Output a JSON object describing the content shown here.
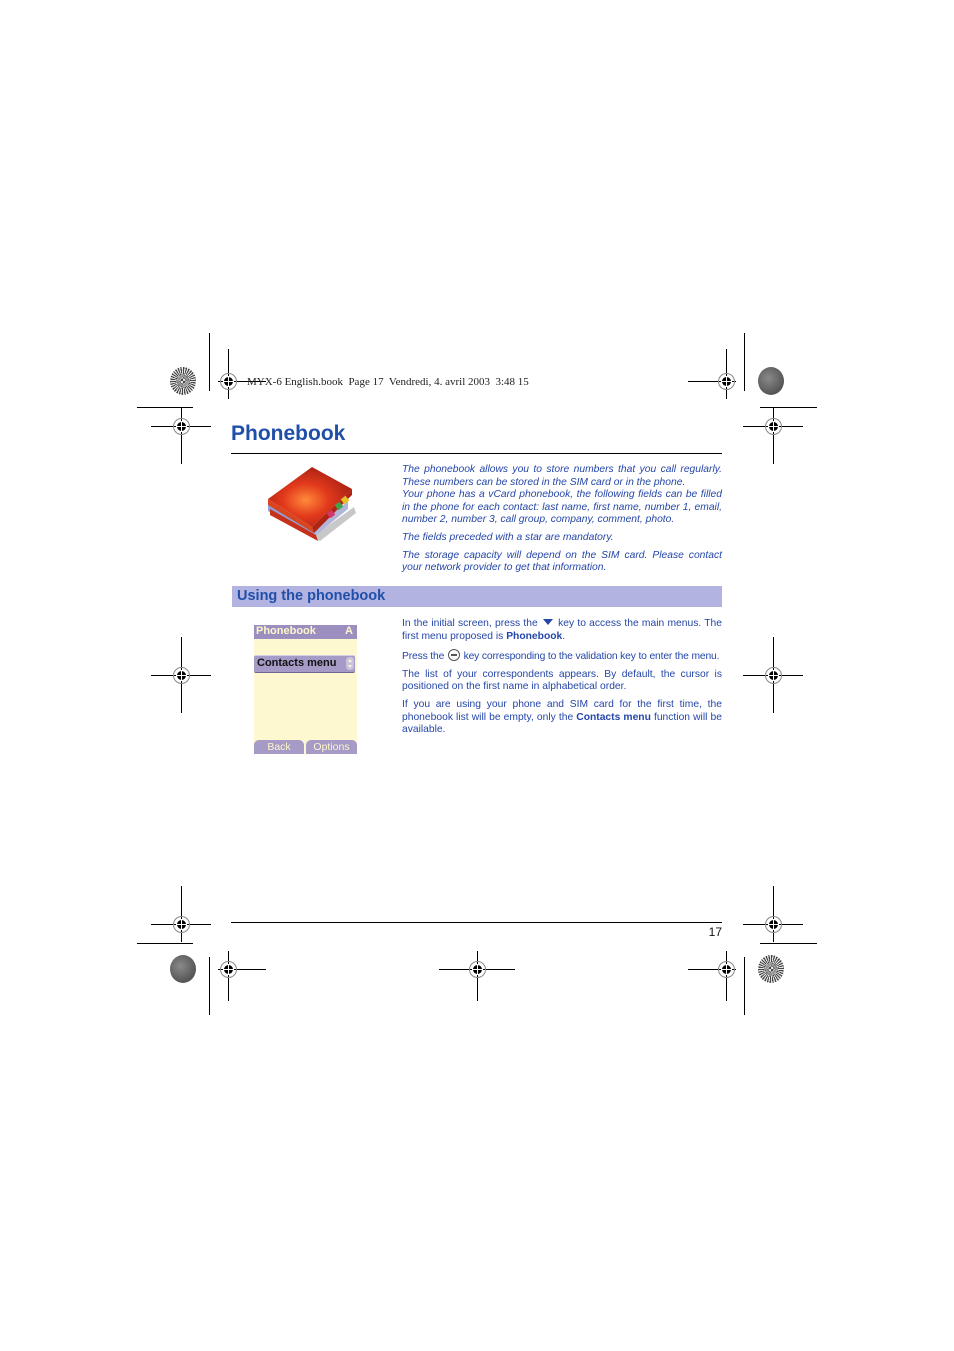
{
  "header": {
    "meta": "MYX-6 English.book  Page 17  Vendredi, 4. avril 2003  3:48 15"
  },
  "page": {
    "title": "Phonebook",
    "number": "17",
    "heading_color": "#1f4fa8",
    "text_color": "#2446a8",
    "section_bar_color": "#b3b3e2"
  },
  "intro": {
    "image": "phonebook-book-icon",
    "paragraphs": [
      "The phonebook allows you to store numbers that you call regularly. These numbers can be stored in the SIM card or in the phone.",
      "Your phone has a vCard phonebook, the following fields can be filled in the phone for each contact: last name, first name, number 1, email, number 2, number 3, call group, company, comment, photo.",
      "The fields preceded with a star are mandatory.",
      "The storage capacity will depend on the SIM card. Please contact your network provider to get that information."
    ]
  },
  "section": {
    "title": "Using the phonebook"
  },
  "phone_screen": {
    "header_title": "Phonebook",
    "header_indicator": "A",
    "selected_item": "Contacts menu",
    "soft_left": "Back",
    "soft_right": "Options"
  },
  "instructions": {
    "p1_before": "In the initial screen, press the",
    "p1_key_icon": "down-arrow-key",
    "p1_after": "key to access the main menus. The first menu proposed is",
    "p1_bold": "Phonebook",
    "p1_end": ".",
    "p2_before": "Press the",
    "p2_key_icon": "ok-validation-key",
    "p2_after": "key corresponding to the validation key to enter the menu.",
    "p3": "The list of your correspondents appears. By default, the cursor is positioned on the first name in alphabetical order.",
    "p4_before": "If you are using your phone and SIM card for the first time, the phonebook list will be empty, only the",
    "p4_bold": "Contacts menu",
    "p4_after": "function will be available."
  }
}
